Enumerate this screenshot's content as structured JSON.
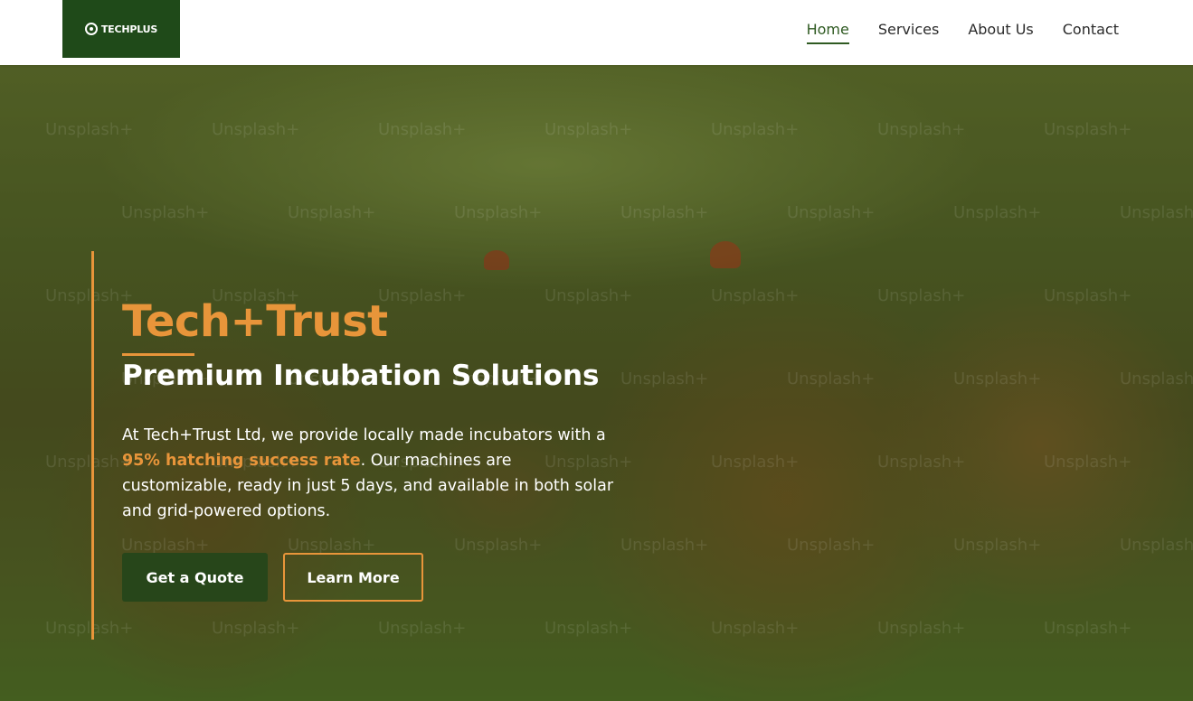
{
  "header": {
    "logo_text": "TECHPLUS",
    "nav": [
      {
        "label": "Home",
        "active": true
      },
      {
        "label": "Services",
        "active": false
      },
      {
        "label": "About Us",
        "active": false
      },
      {
        "label": "Contact",
        "active": false
      }
    ]
  },
  "hero": {
    "title": "Tech+Trust",
    "subtitle": "Premium Incubation Solutions",
    "desc_before": "At Tech+Trust Ltd, we provide locally made incubators with a ",
    "desc_highlight": "95% hatching success rate",
    "desc_after": ". Our machines are customizable, ready in just 5 days, and available in both solar and grid-powered options.",
    "primary_button": "Get a Quote",
    "secondary_button": "Learn More",
    "watermark_text": "Unsplash+"
  },
  "colors": {
    "accent": "#e8953a",
    "brand_green": "#27461a",
    "nav_active": "#2f5a22"
  }
}
